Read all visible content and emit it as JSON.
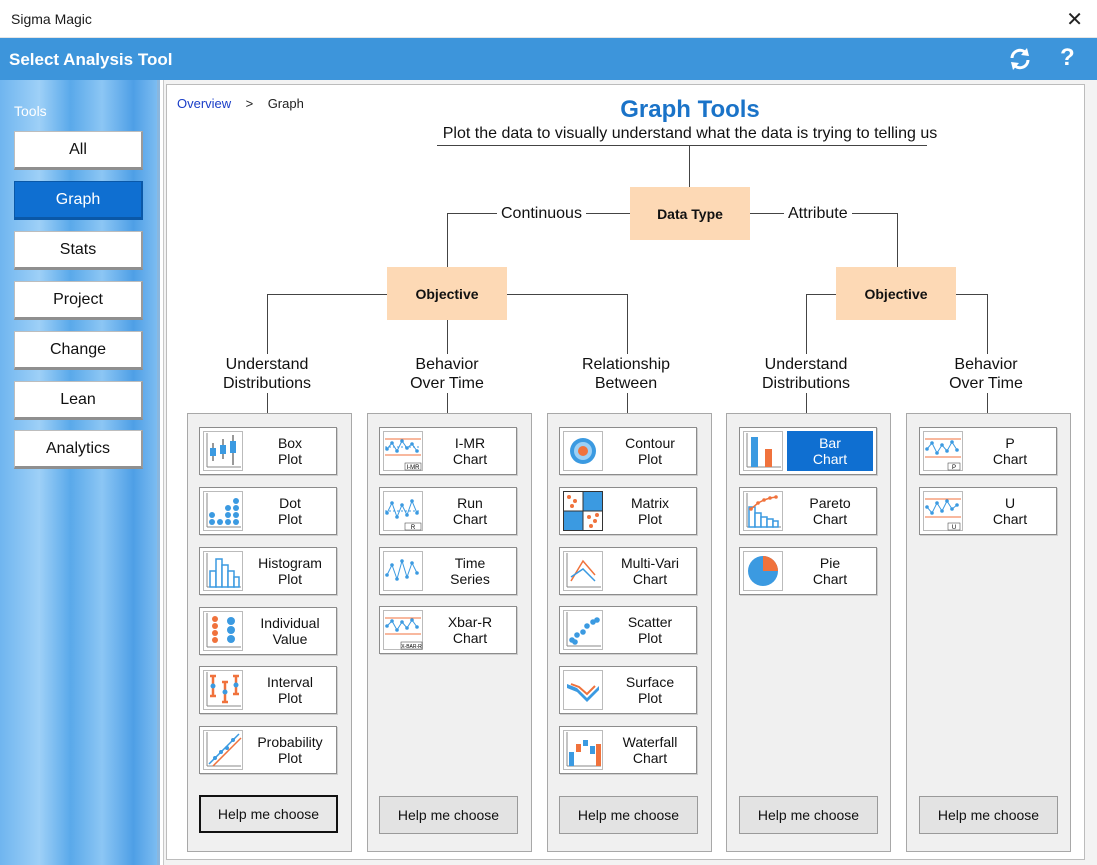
{
  "window": {
    "title": "Sigma Magic",
    "close_glyph": "✕"
  },
  "header": {
    "title": "Select Analysis Tool",
    "help_glyph": "?"
  },
  "sidebar": {
    "label": "Tools",
    "items": [
      "All",
      "Graph",
      "Stats",
      "Project",
      "Change",
      "Lean",
      "Analytics"
    ],
    "active": "Graph"
  },
  "breadcrumb": {
    "link": "Overview",
    "separator": ">",
    "current": "Graph"
  },
  "page": {
    "title": "Graph Tools",
    "subtitle": "Plot the data to visually understand what the data is trying to telling us"
  },
  "tree": {
    "root": "Data Type",
    "left_branch": "Continuous",
    "right_branch": "Attribute",
    "objective_label": "Objective"
  },
  "columns": [
    {
      "heading": [
        "Understand",
        "Distributions"
      ],
      "tools": [
        {
          "line1": "Box",
          "line2": "Plot",
          "icon": "box-plot-icon"
        },
        {
          "line1": "Dot",
          "line2": "Plot",
          "icon": "dot-plot-icon"
        },
        {
          "line1": "Histogram",
          "line2": "Plot",
          "icon": "histogram-icon"
        },
        {
          "line1": "Individual",
          "line2": "Value",
          "icon": "individual-value-icon"
        },
        {
          "line1": "Interval",
          "line2": "Plot",
          "icon": "interval-plot-icon"
        },
        {
          "line1": "Probability",
          "line2": "Plot",
          "icon": "probability-plot-icon"
        }
      ],
      "help": "Help me choose"
    },
    {
      "heading": [
        "Behavior",
        "Over Time"
      ],
      "tools": [
        {
          "line1": "I-MR",
          "line2": "Chart",
          "icon": "imr-chart-icon",
          "tag": "I-MR"
        },
        {
          "line1": "Run",
          "line2": "Chart",
          "icon": "run-chart-icon",
          "tag": "R"
        },
        {
          "line1": "Time",
          "line2": "Series",
          "icon": "time-series-icon"
        },
        {
          "line1": "Xbar-R",
          "line2": "Chart",
          "icon": "xbar-r-chart-icon",
          "tag": "X-BAR-R"
        }
      ],
      "help": "Help me choose"
    },
    {
      "heading": [
        "Relationship",
        "Between"
      ],
      "tools": [
        {
          "line1": "Contour",
          "line2": "Plot",
          "icon": "contour-plot-icon"
        },
        {
          "line1": "Matrix",
          "line2": "Plot",
          "icon": "matrix-plot-icon"
        },
        {
          "line1": "Multi-Vari",
          "line2": "Chart",
          "icon": "multi-vari-icon"
        },
        {
          "line1": "Scatter",
          "line2": "Plot",
          "icon": "scatter-plot-icon"
        },
        {
          "line1": "Surface",
          "line2": "Plot",
          "icon": "surface-plot-icon"
        },
        {
          "line1": "Waterfall",
          "line2": "Chart",
          "icon": "waterfall-chart-icon"
        }
      ],
      "help": "Help me choose"
    },
    {
      "heading": [
        "Understand",
        "Distributions"
      ],
      "tools": [
        {
          "line1": "Bar",
          "line2": "Chart",
          "icon": "bar-chart-icon",
          "selected": true
        },
        {
          "line1": "Pareto",
          "line2": "Chart",
          "icon": "pareto-chart-icon"
        },
        {
          "line1": "Pie",
          "line2": "Chart",
          "icon": "pie-chart-icon"
        }
      ],
      "help": "Help me choose"
    },
    {
      "heading": [
        "Behavior",
        "Over Time"
      ],
      "tools": [
        {
          "line1": "P",
          "line2": "Chart",
          "icon": "p-chart-icon",
          "tag": "P"
        },
        {
          "line1": "U",
          "line2": "Chart",
          "icon": "u-chart-icon",
          "tag": "U"
        }
      ],
      "help": "Help me choose"
    }
  ],
  "colors": {
    "header": "#3d95db",
    "accent": "#0f6fd1",
    "peach": "#fdd9b5",
    "title": "#1a73c8",
    "icon_blue": "#3b9ae1",
    "icon_orange": "#f0723c"
  }
}
